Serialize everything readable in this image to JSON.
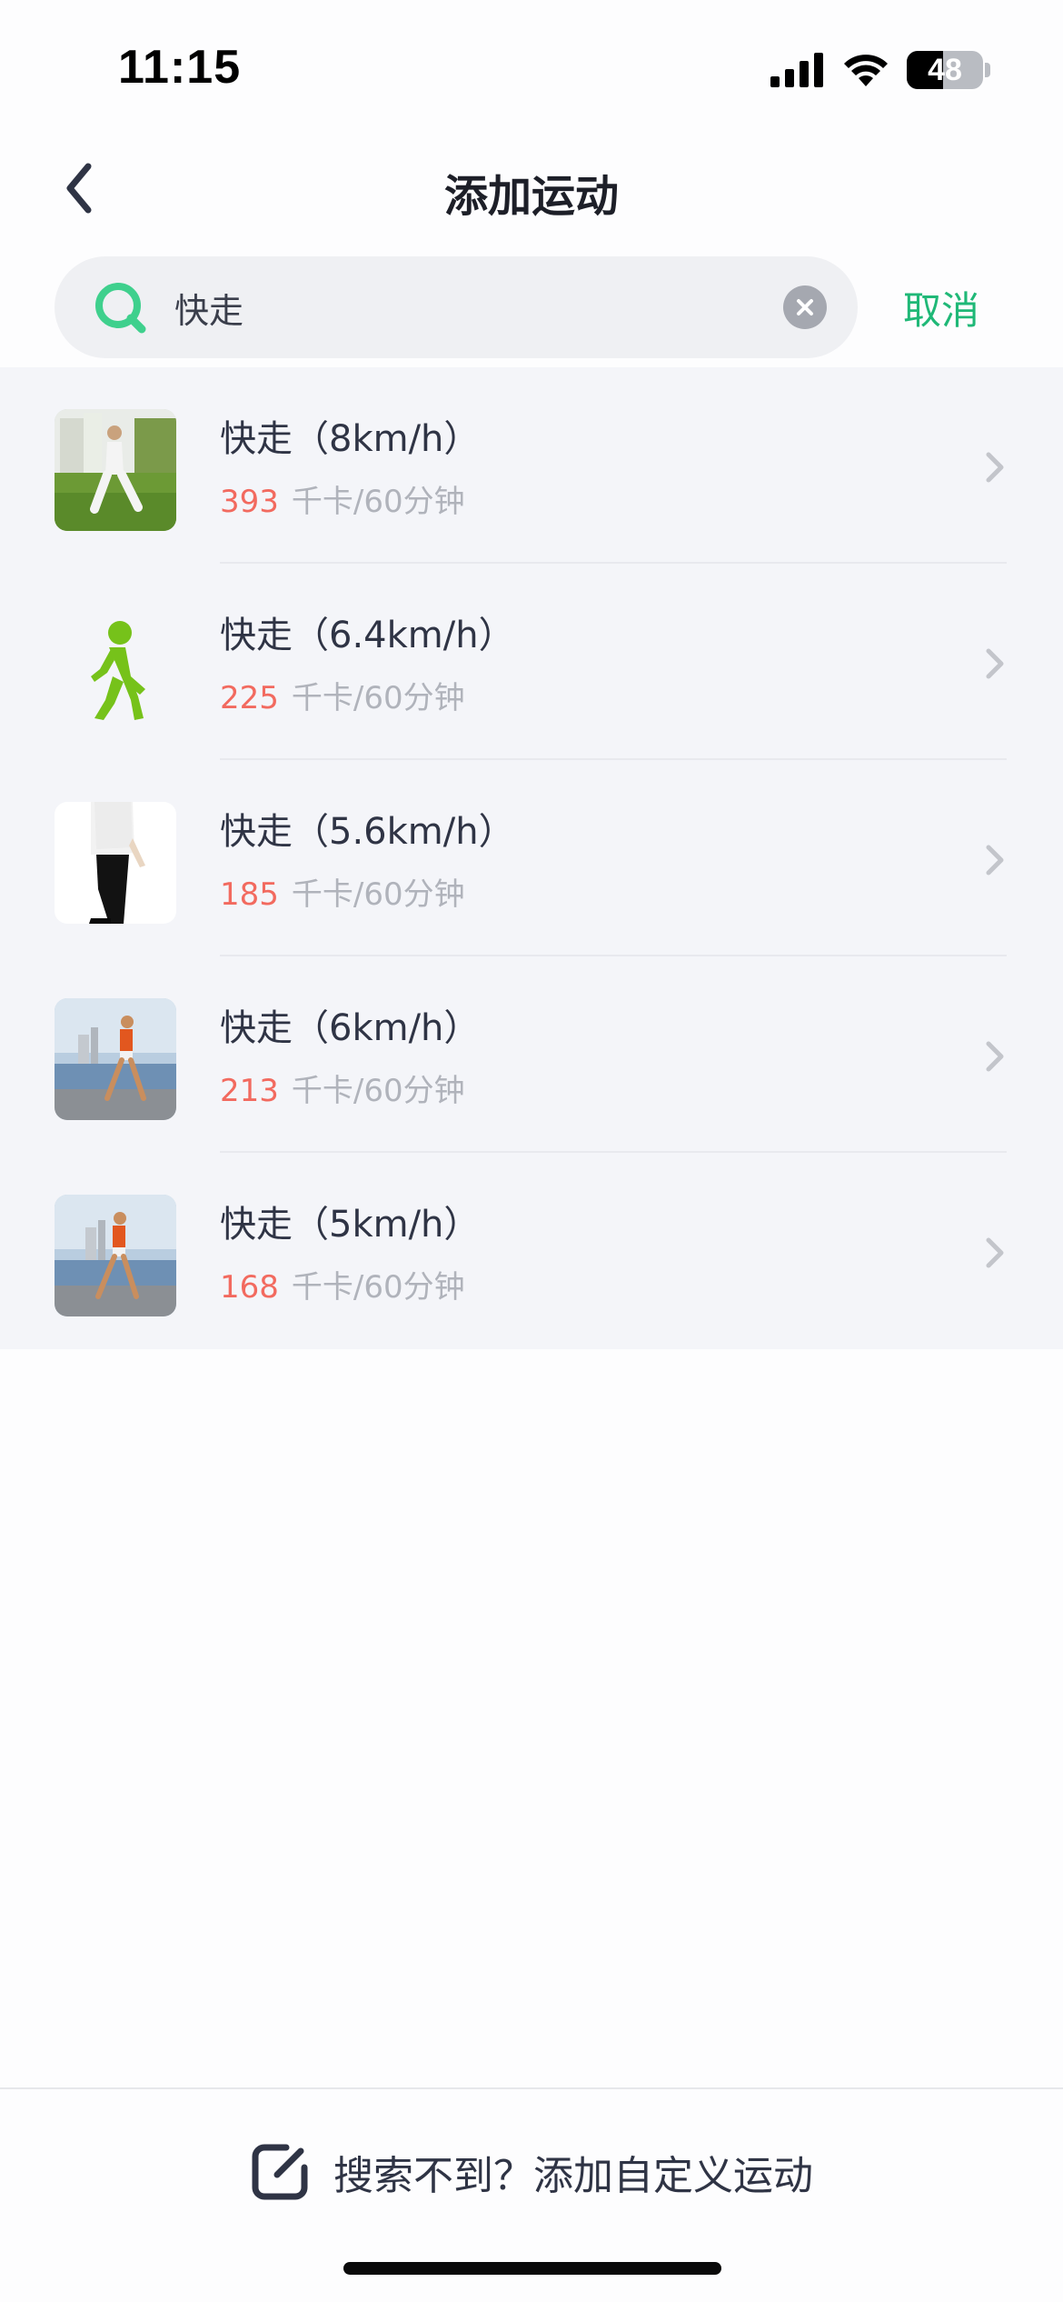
{
  "status_bar": {
    "time": "11:15",
    "battery": "48",
    "battery_level_percent": 48,
    "icons": [
      "cellular-signal-icon",
      "wifi-icon",
      "battery-icon"
    ]
  },
  "nav": {
    "title": "添加运动",
    "back_icon": "chevron-left-icon"
  },
  "search": {
    "value": "快走",
    "icon": "search-icon",
    "clear_icon": "clear-icon",
    "cancel_label": "取消"
  },
  "results": [
    {
      "title": "快走（8km/h）",
      "calories": "393",
      "unit": "千卡/60分钟",
      "thumbnail": "walker-park-photo"
    },
    {
      "title": "快走（6.4km/h）",
      "calories": "225",
      "unit": "千卡/60分钟",
      "thumbnail": "green-walking-figure-icon"
    },
    {
      "title": "快走（5.6km/h）",
      "calories": "185",
      "unit": "千卡/60分钟",
      "thumbnail": "walker-white-shirt-photo"
    },
    {
      "title": "快走（6km/h）",
      "calories": "213",
      "unit": "千卡/60分钟",
      "thumbnail": "walker-seaside-photo"
    },
    {
      "title": "快走（5km/h）",
      "calories": "168",
      "unit": "千卡/60分钟",
      "thumbnail": "walker-seaside-photo"
    }
  ],
  "bottom": {
    "custom_label": "搜索不到？添加自定义运动",
    "icon": "edit-square-icon"
  },
  "colors": {
    "accent_green": "#1fb877",
    "calorie_red": "#f26a5f",
    "list_background": "#f4f5f9",
    "search_background": "#eff0f3"
  }
}
